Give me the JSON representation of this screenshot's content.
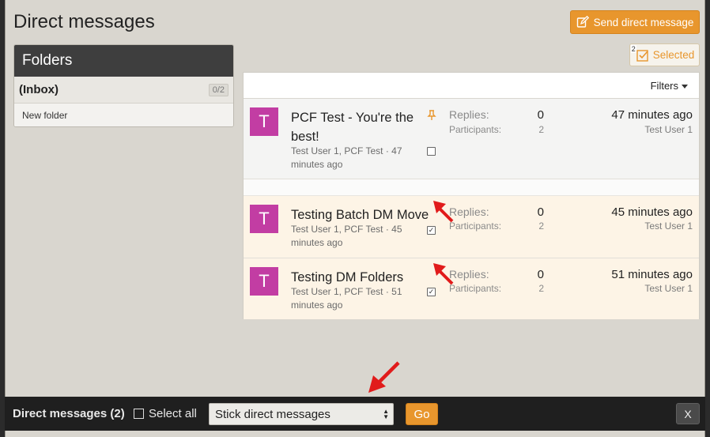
{
  "page": {
    "title": "Direct messages"
  },
  "toolbar": {
    "send_label": "Send direct message",
    "selected_label": "Selected",
    "selected_count": "2"
  },
  "sidebar": {
    "heading": "Folders",
    "inbox_label": "(Inbox)",
    "inbox_badge": "0/2",
    "new_folder_label": "New folder"
  },
  "list": {
    "filters_label": "Filters",
    "replies_label": "Replies:",
    "participants_label": "Participants:",
    "items": [
      {
        "avatar": "T",
        "title": "PCF Test - You're the best!",
        "meta": "Test User 1, PCF Test · 47 minutes ago",
        "replies": "0",
        "participants": "2",
        "time": "47 minutes ago",
        "last_user": "Test User 1",
        "pinned": true,
        "checked": false
      },
      {
        "avatar": "T",
        "title": "Testing Batch DM Move",
        "meta": "Test User 1, PCF Test · 45 minutes ago",
        "replies": "0",
        "participants": "2",
        "time": "45 minutes ago",
        "last_user": "Test User 1",
        "pinned": false,
        "checked": true
      },
      {
        "avatar": "T",
        "title": "Testing DM Folders",
        "meta": "Test User 1, PCF Test · 51 minutes ago",
        "replies": "0",
        "participants": "2",
        "time": "51 minutes ago",
        "last_user": "Test User 1",
        "pinned": false,
        "checked": true
      }
    ]
  },
  "bottom_bar": {
    "title": "Direct messages (2)",
    "select_all_label": "Select all",
    "action_value": "Stick direct messages",
    "go_label": "Go",
    "close_label": "X"
  },
  "colors": {
    "accent": "#e8962d",
    "avatar": "#c23da3",
    "header_dark": "#3e3e3e",
    "selected_row": "#fdf4e6",
    "arrow": "#e11b1b"
  },
  "icons": {
    "send": "edit-icon",
    "selected": "checkbox-selected-icon",
    "pin": "thumbtack-icon",
    "filters": "caret-down-icon"
  }
}
